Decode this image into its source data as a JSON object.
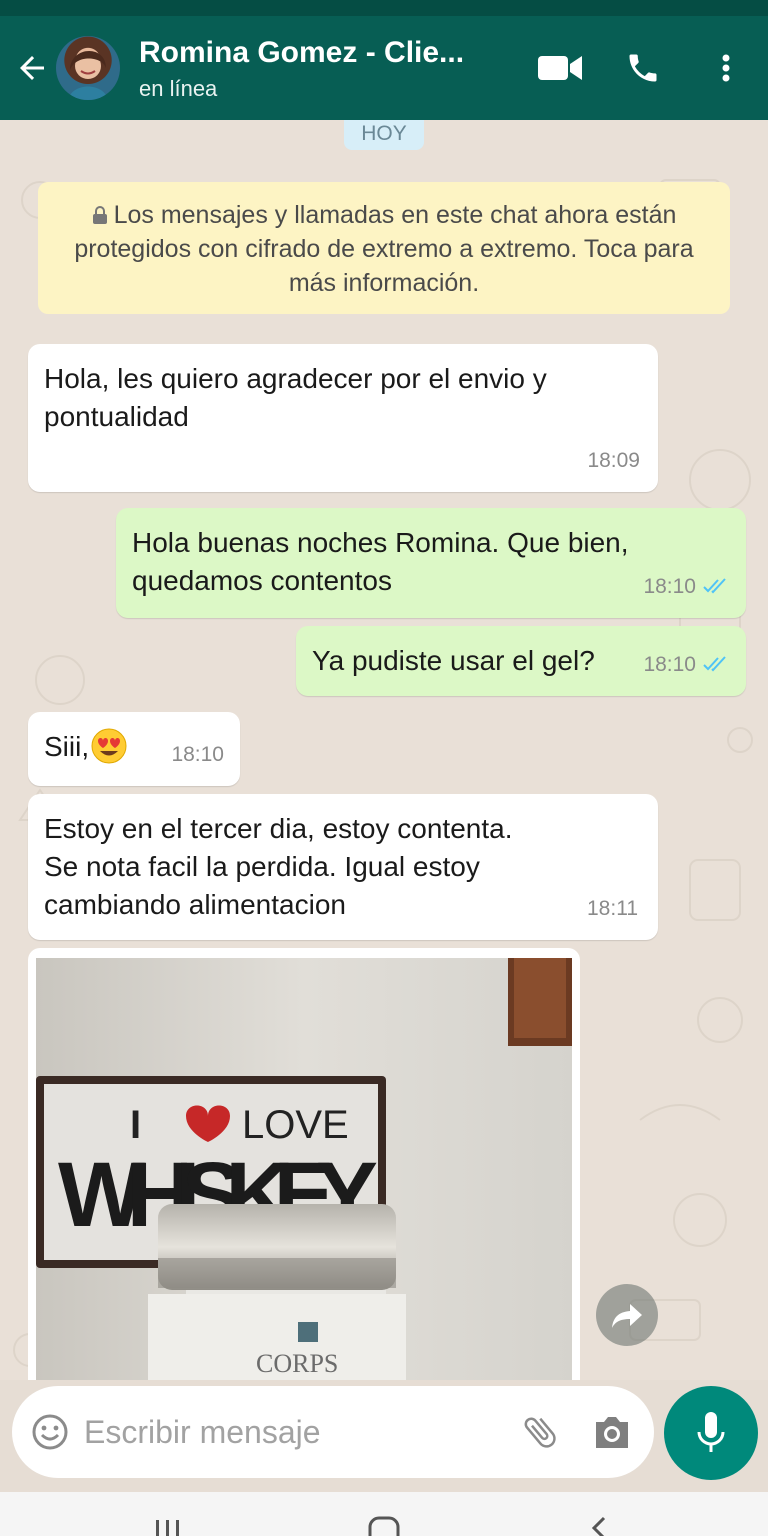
{
  "header": {
    "contact_name": "Romina Gomez - Clie...",
    "status": "en línea",
    "icons": [
      "back-arrow-icon",
      "avatar",
      "video-call-icon",
      "phone-icon",
      "more-vert-icon"
    ],
    "background": "#075e54"
  },
  "chat": {
    "date_chip": "HOY",
    "encryption_notice": "Los mensajes y llamadas en este chat ahora están protegidos con cifrado de extremo a extremo. Toca para más información.",
    "messages": [
      {
        "direction": "in",
        "lines": [
          "Hola, les quiero agradecer por el envio y",
          "pontualidad"
        ],
        "time": "18:09"
      },
      {
        "direction": "out",
        "lines": [
          "Hola buenas noches Romina. Que bien,",
          "quedamos contentos"
        ],
        "time": "18:10",
        "status": "read"
      },
      {
        "direction": "out",
        "lines": [
          "Ya pudiste usar el gel?"
        ],
        "time": "18:10",
        "status": "read"
      },
      {
        "direction": "in",
        "lines": [
          "Siii,"
        ],
        "time": "18:10",
        "emoji": "heart-eyes"
      },
      {
        "direction": "in",
        "lines": [
          "Estoy en el tercer dia, estoy contenta.",
          "Se nota facil la perdida. Igual estoy",
          "cambiando alimentacion"
        ],
        "time": "18:11"
      }
    ],
    "photo": {
      "sign_text_top_i": "I",
      "sign_text_top_love": "LOVE",
      "sign_text_main": "WHISKEY",
      "jar_label": "CORPS"
    }
  },
  "composer": {
    "placeholder": "Escribir mensaje",
    "icons": [
      "emoji-icon",
      "attach-icon",
      "camera-icon",
      "mic-icon"
    ]
  },
  "colors": {
    "header": "#075e54",
    "incoming_bubble": "#ffffff",
    "outgoing_bubble": "#dcf8c6",
    "notice_bg": "#fdf4c4",
    "accent": "#00897b",
    "read_ticks": "#4fc3f7"
  }
}
